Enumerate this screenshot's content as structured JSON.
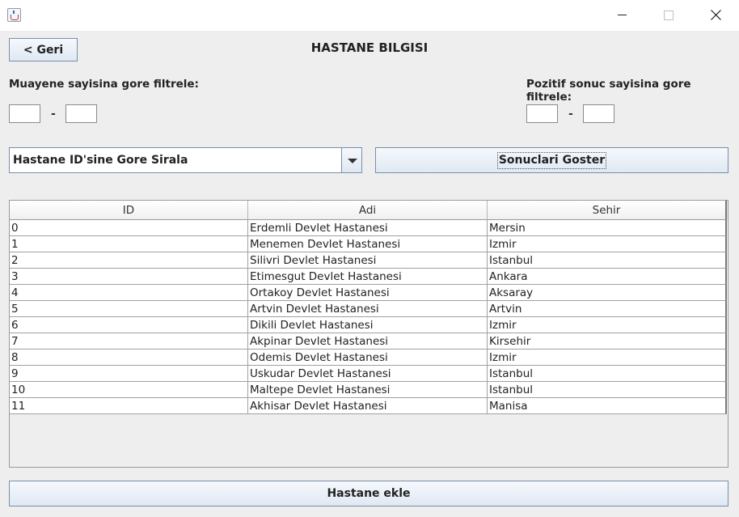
{
  "window": {
    "app_icon": "java-cup-icon"
  },
  "header": {
    "back_label": "< Geri",
    "title": "HASTANE BILGISI"
  },
  "filters": {
    "exam_label": "Muayene sayisina gore filtrele:",
    "exam_min": "",
    "exam_max": "",
    "positive_label": "Pozitif sonuc sayisina gore filtrele:",
    "positive_min": "",
    "positive_max": "",
    "separator": "-"
  },
  "sort": {
    "selected": "Hastane ID'sine Gore Sirala"
  },
  "show_results_label": "Sonuclari Goster",
  "table": {
    "columns": [
      "ID",
      "Adi",
      "Sehir"
    ],
    "rows": [
      [
        "0",
        "Erdemli Devlet Hastanesi",
        "Mersin"
      ],
      [
        "1",
        "Menemen Devlet Hastanesi",
        "Izmir"
      ],
      [
        "2",
        "Silivri Devlet Hastanesi",
        "Istanbul"
      ],
      [
        "3",
        "Etimesgut Devlet Hastanesi",
        "Ankara"
      ],
      [
        "4",
        "Ortakoy Devlet Hastanesi",
        "Aksaray"
      ],
      [
        "5",
        "Artvin Devlet Hastanesi",
        "Artvin"
      ],
      [
        "6",
        "Dikili Devlet Hastanesi",
        "Izmir"
      ],
      [
        "7",
        "Akpinar Devlet Hastanesi",
        "Kirsehir"
      ],
      [
        "8",
        "Odemis Devlet Hastanesi",
        "Izmir"
      ],
      [
        "9",
        "Uskudar Devlet Hastanesi",
        "Istanbul"
      ],
      [
        "10",
        "Maltepe Devlet Hastanesi",
        "Istanbul"
      ],
      [
        "11",
        "Akhisar Devlet Hastanesi",
        "Manisa"
      ]
    ]
  },
  "add_button_label": "Hastane ekle"
}
